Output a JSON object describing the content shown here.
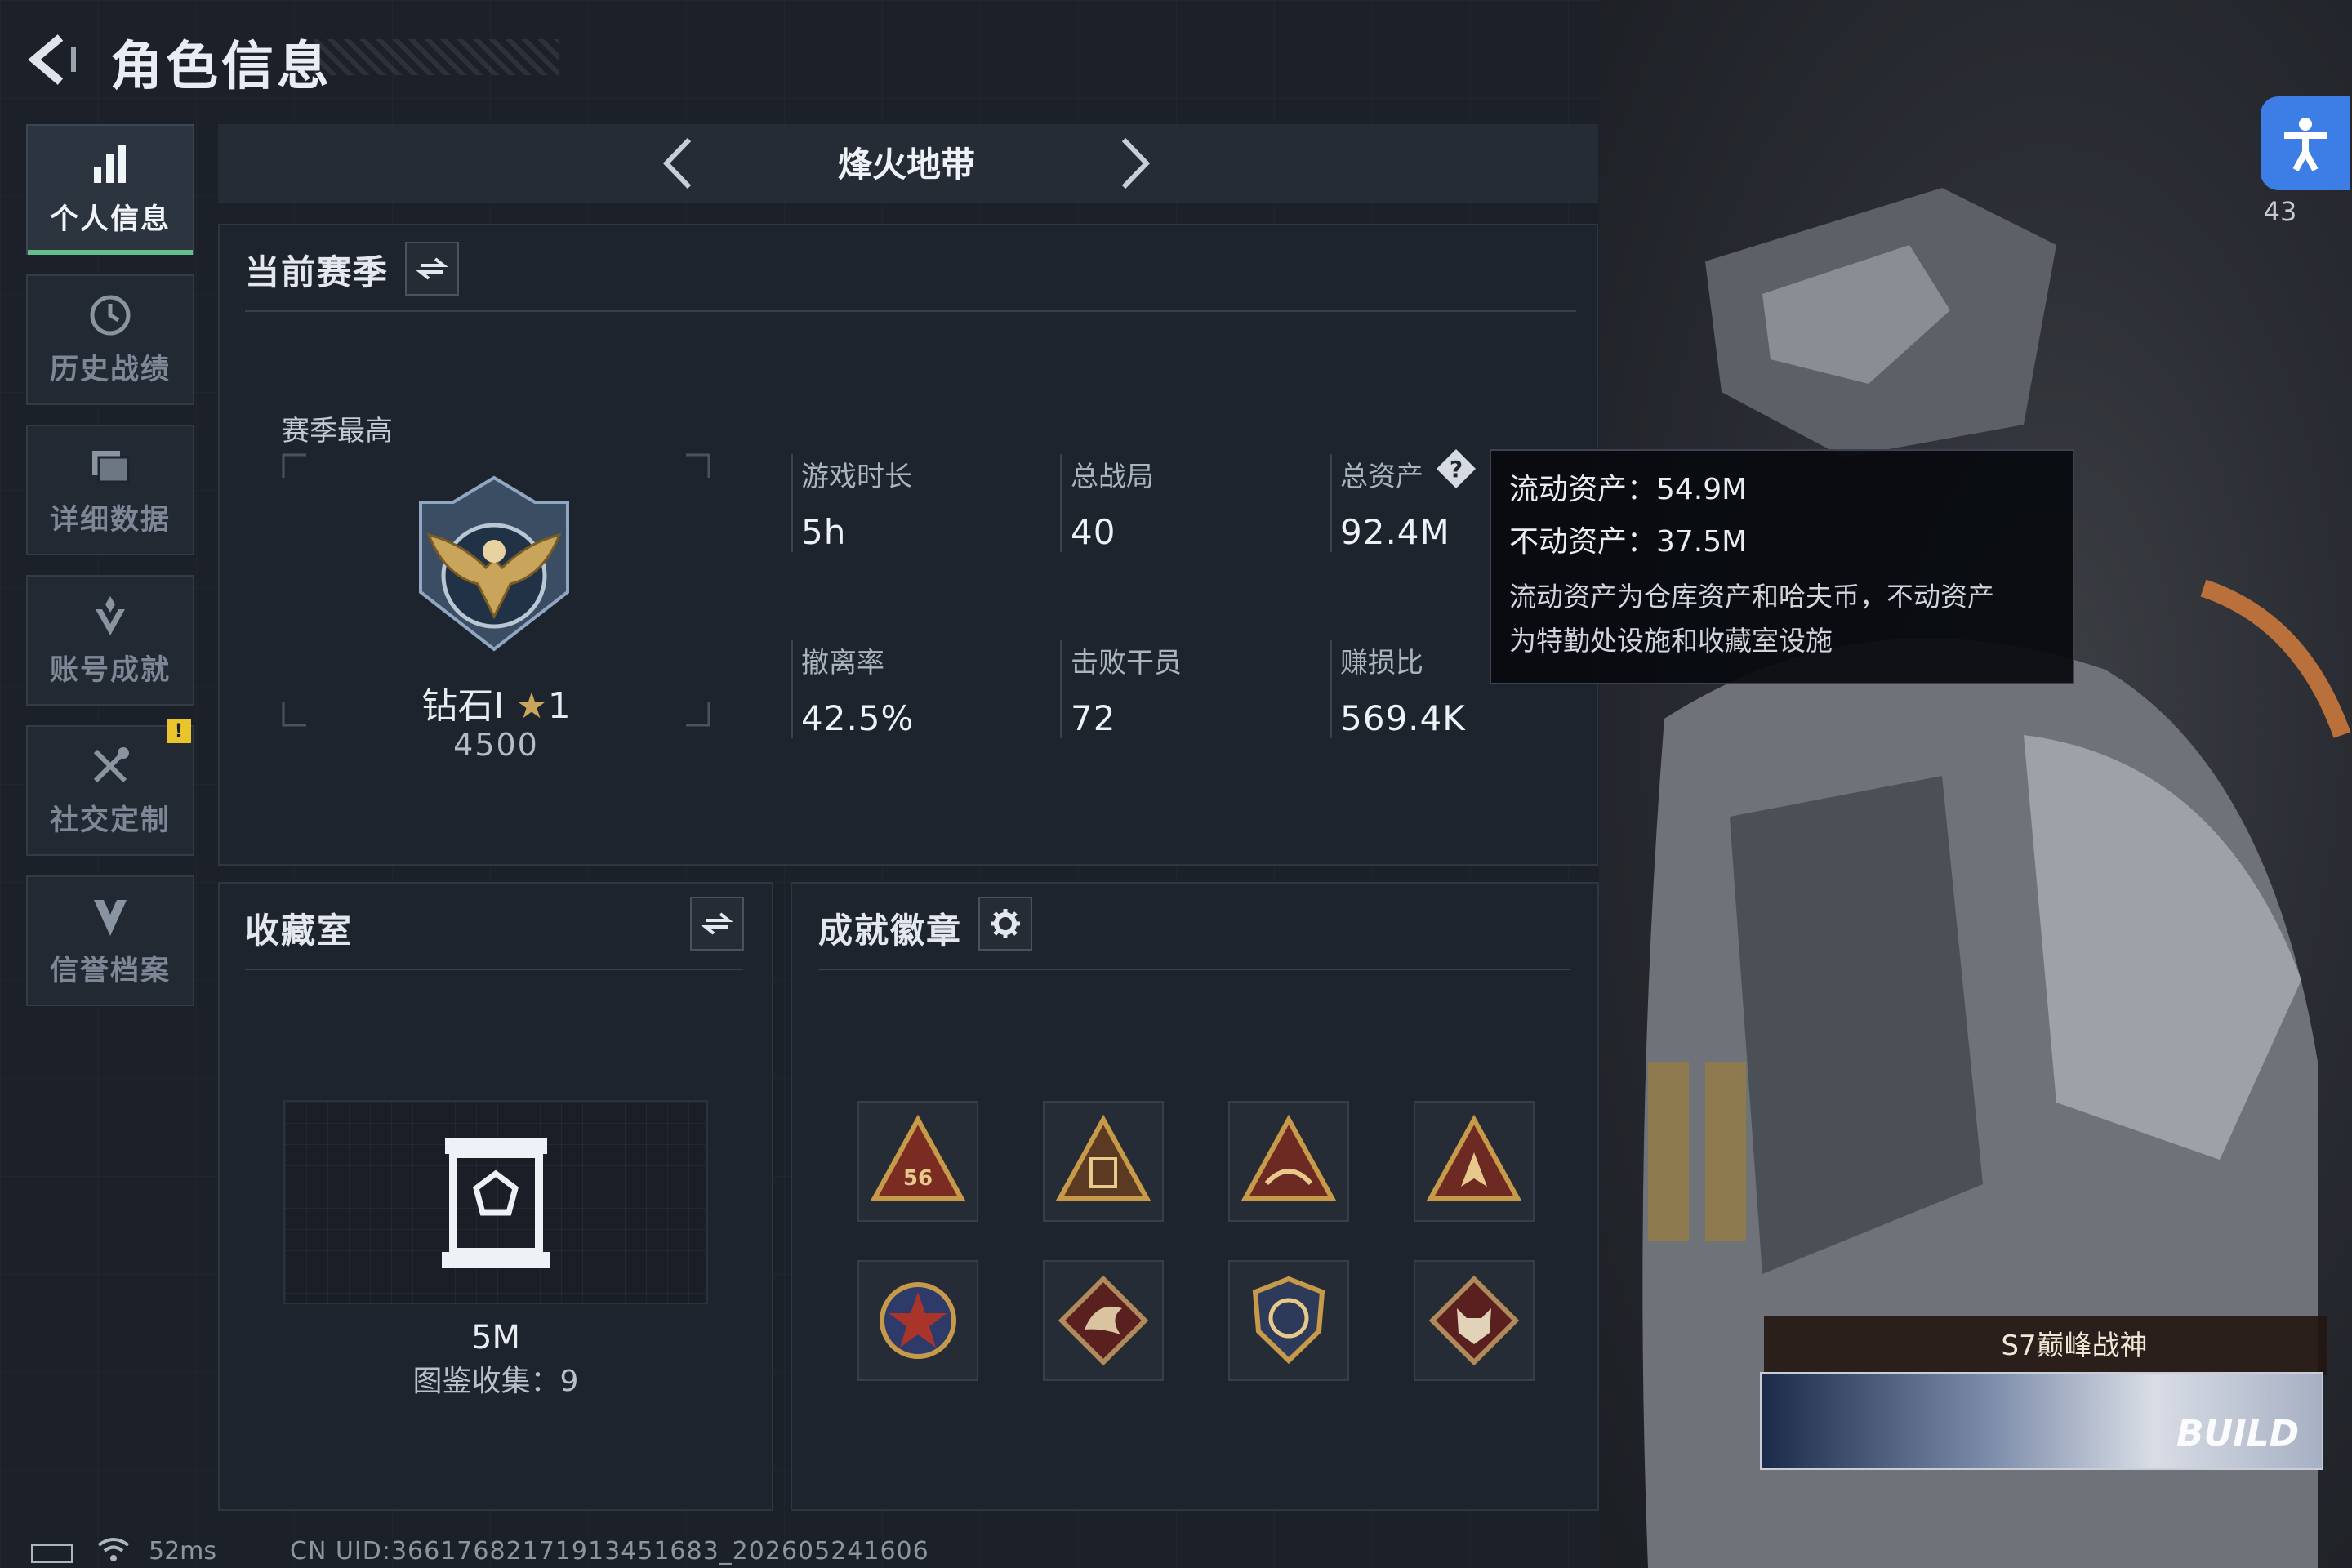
{
  "header": {
    "title": "角色信息"
  },
  "sidebar": {
    "items": [
      {
        "label": "个人信息",
        "icon": "bar-chart-icon",
        "active": true
      },
      {
        "label": "历史战绩",
        "icon": "history-icon"
      },
      {
        "label": "详细数据",
        "icon": "folder-icon"
      },
      {
        "label": "账号成就",
        "icon": "achievement-icon"
      },
      {
        "label": "社交定制",
        "icon": "tools-icon",
        "alert": "!"
      },
      {
        "label": "信誉档案",
        "icon": "shield-icon"
      }
    ]
  },
  "mode": {
    "label": "烽火地带"
  },
  "season": {
    "title": "当前赛季",
    "best_label": "赛季最高",
    "rank_name": "钻石Ⅰ",
    "rank_stars": "1",
    "rank_score": "4500",
    "stats": [
      {
        "label": "游戏时长",
        "value": "5h"
      },
      {
        "label": "总战局",
        "value": "40"
      },
      {
        "label": "总资产",
        "value": "92.4M"
      },
      {
        "label": "撤离率",
        "value": "42.5%"
      },
      {
        "label": "击败干员",
        "value": "72"
      },
      {
        "label": "赚损比",
        "value": "569.4K"
      }
    ]
  },
  "asset_tooltip": {
    "liquid": "流动资产：54.9M",
    "fixed": "不动资产：37.5M",
    "desc_line1": "流动资产为仓库资产和哈夫币，不动资产",
    "desc_line2": "为特勤处设施和收藏室设施"
  },
  "collection": {
    "title": "收藏室",
    "value": "5M",
    "count_label": "图鉴收集：9"
  },
  "badges": {
    "title": "成就徽章",
    "items": [
      "badge-56",
      "badge-57",
      "badge-triangle",
      "badge-triangle-2",
      "badge-star",
      "badge-dragon",
      "badge-shield",
      "badge-wolf"
    ]
  },
  "character": {
    "title_card": "S7巅峰战神",
    "ping_count": "43",
    "banner_text": "BUILD"
  },
  "status_bar": {
    "latency": "52ms",
    "uid": "CN UID:3661768217191345168​3_202605241606"
  },
  "colors": {
    "accent_green": "#63c08c",
    "warning_yellow": "#e9c42a",
    "badge_gold": "#c79a4a",
    "badge_red": "#8a2f25",
    "accessibility_blue": "#3d7ee6"
  }
}
